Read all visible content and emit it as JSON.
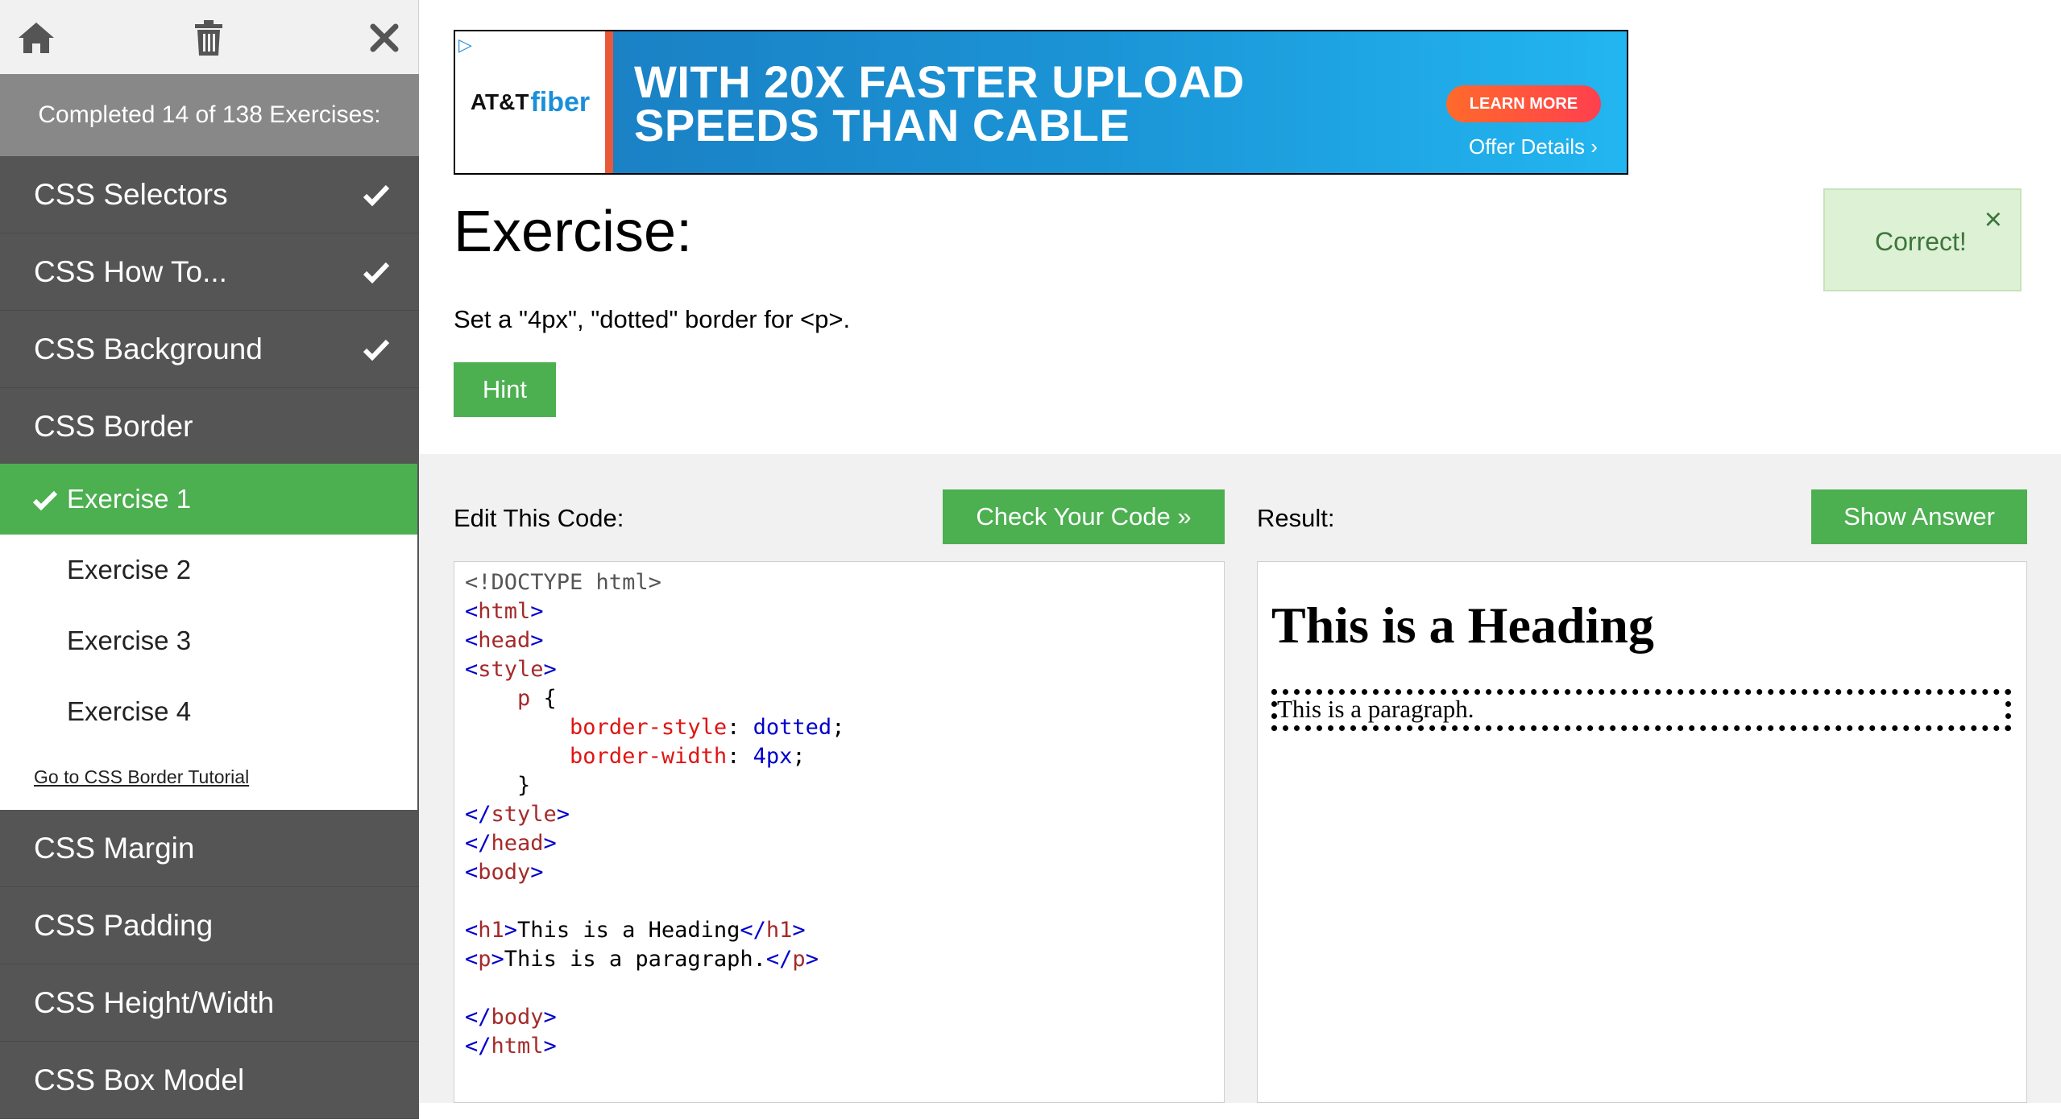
{
  "sidebar": {
    "progress_text": "Completed 14 of 138 Exercises:",
    "categories_top": [
      {
        "label": "CSS Selectors",
        "completed": true
      },
      {
        "label": "CSS How To...",
        "completed": true
      },
      {
        "label": "CSS Background",
        "completed": true
      },
      {
        "label": "CSS Border",
        "completed": false
      }
    ],
    "exercises": [
      {
        "label": "Exercise 1",
        "active": true,
        "completed": true
      },
      {
        "label": "Exercise 2",
        "active": false,
        "completed": false
      },
      {
        "label": "Exercise 3",
        "active": false,
        "completed": false
      },
      {
        "label": "Exercise 4",
        "active": false,
        "completed": false
      }
    ],
    "tutorial_link": "Go to CSS Border Tutorial",
    "categories_bottom": [
      {
        "label": "CSS Margin"
      },
      {
        "label": "CSS Padding"
      },
      {
        "label": "CSS Height/Width"
      },
      {
        "label": "CSS Box Model"
      }
    ],
    "icons": [
      "home-icon",
      "trash-icon",
      "close-icon"
    ]
  },
  "ad": {
    "brand_att": "AT&T",
    "brand_fiber": "fiber",
    "headline_line1": "WITH 20X FASTER UPLOAD",
    "headline_line2": "SPEEDS THAN CABLE",
    "cta": "LEARN MORE",
    "offer": "Offer Details"
  },
  "exercise": {
    "title": "Exercise:",
    "description": "Set a \"4px\", \"dotted\" border for <p>.",
    "hint_label": "Hint"
  },
  "feedback": {
    "message": "Correct!",
    "close": "×"
  },
  "editor": {
    "label": "Edit This Code:",
    "check_label": "Check Your Code »",
    "code": {
      "doctype": "<!DOCTYPE html>",
      "html_open": "html",
      "head_open": "head",
      "style_open": "style",
      "selector": "p",
      "prop1": "border-style",
      "val1": "dotted",
      "prop2": "border-width",
      "val2": "4px",
      "style_close": "style",
      "head_close": "head",
      "body_open": "body",
      "h1_tag": "h1",
      "h1_text": "This is a Heading",
      "p_tag": "p",
      "p_text": "This is a paragraph.",
      "body_close": "body",
      "html_close": "html"
    }
  },
  "result": {
    "label": "Result:",
    "answer_label": "Show Answer",
    "heading": "This is a Heading",
    "paragraph": "This is a paragraph."
  },
  "colors": {
    "green": "#4caf50",
    "sidebar_dark": "#555555",
    "sidebar_progress": "#888888",
    "success_bg": "#ddf1d4",
    "success_text": "#3c763d"
  }
}
